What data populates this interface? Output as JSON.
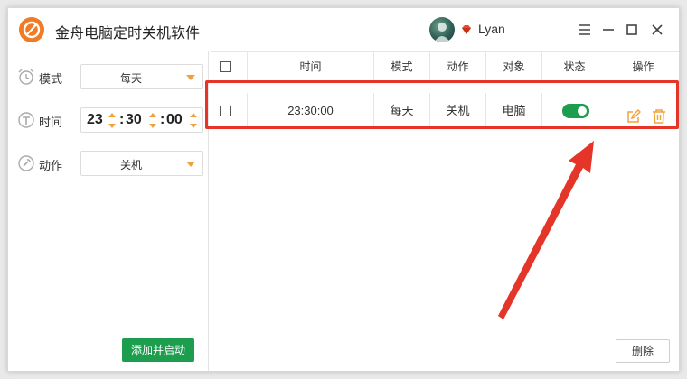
{
  "app": {
    "title": "金舟电脑定时关机软件",
    "username": "Lyan"
  },
  "icons": {
    "logo": "jinzhou-logo-icon",
    "vip": "vip-diamond-icon",
    "menu": "menu-icon",
    "minimize": "minimize-icon",
    "maximize": "maximize-icon",
    "close": "close-icon"
  },
  "sidebar": {
    "mode": {
      "label": "模式",
      "value": "每天",
      "icon": "alarm-clock-icon"
    },
    "time": {
      "label": "时间",
      "icon": "timer-icon",
      "hour": "23",
      "minute": "30",
      "second": "00"
    },
    "action": {
      "label": "动作",
      "value": "关机",
      "icon": "wrench-icon"
    },
    "add_button": "添加并启动"
  },
  "table": {
    "headers": [
      "时间",
      "模式",
      "动作",
      "对象",
      "状态",
      "操作"
    ],
    "rows": [
      {
        "time": "23:30:00",
        "mode": "每天",
        "action": "关机",
        "target": "电脑",
        "enabled": true
      }
    ]
  },
  "footer": {
    "delete_button": "删除"
  },
  "colors": {
    "accent_orange": "#f0a23a",
    "green": "#1d9d4e",
    "highlight_red": "#e53428",
    "logo_orange": "#f07b22"
  }
}
